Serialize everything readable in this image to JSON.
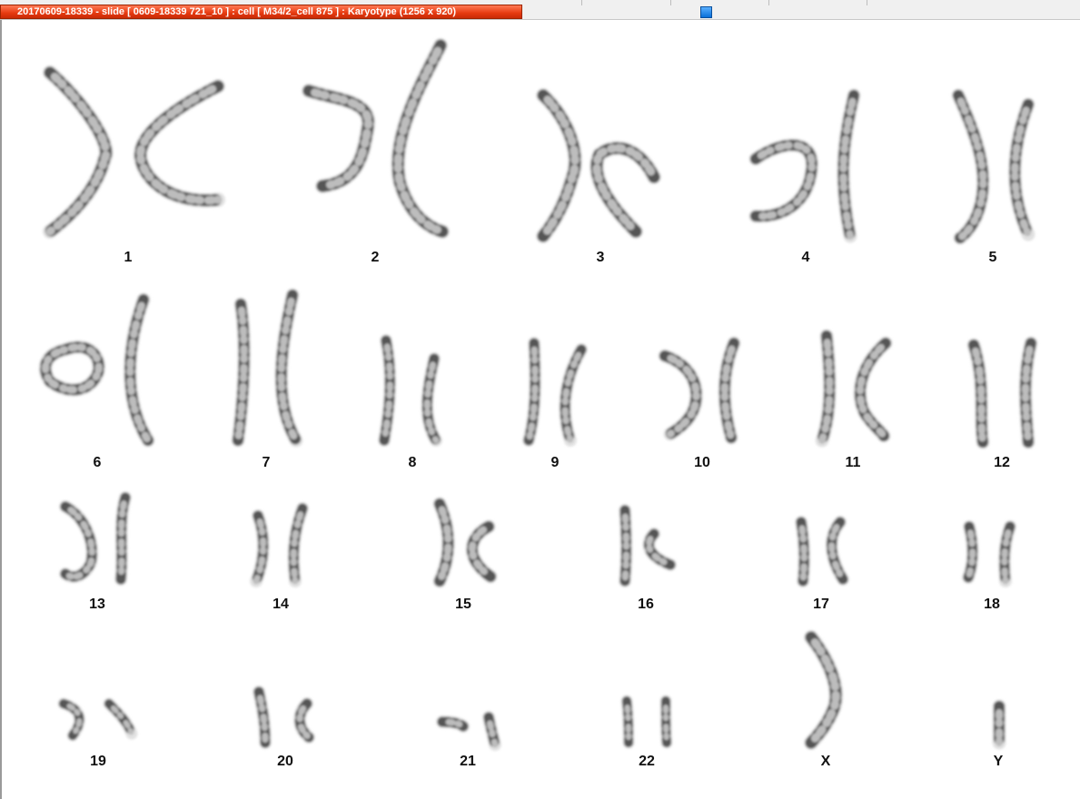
{
  "window": {
    "title": "20170609-18339 - slide [ 0609-18339 721_10 ] : cell [ M34/2_cell 875 ] : Karyotype  (1256 x 920)"
  },
  "toolbar": {
    "icon": "blue-square-button-icon",
    "accent": "#1a7fe8"
  },
  "colors": {
    "title_bar": "#e63a10",
    "chromosome": "#555555"
  },
  "karyotype": {
    "labels": [
      "1",
      "2",
      "3",
      "4",
      "5",
      "6",
      "7",
      "8",
      "9",
      "10",
      "11",
      "12",
      "13",
      "14",
      "15",
      "16",
      "17",
      "18",
      "19",
      "20",
      "21",
      "22",
      "X",
      "Y"
    ]
  }
}
